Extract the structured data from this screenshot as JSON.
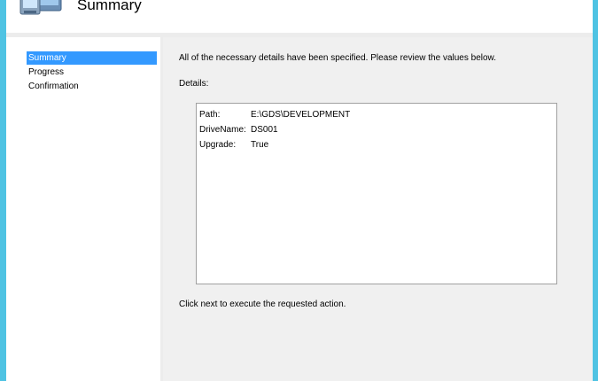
{
  "header": {
    "title": "Summary",
    "icon": "computer-icon"
  },
  "sidebar": {
    "items": [
      {
        "label": "Summary",
        "active": true
      },
      {
        "label": "Progress",
        "active": false
      },
      {
        "label": "Confirmation",
        "active": false
      }
    ]
  },
  "main": {
    "intro": "All of the necessary details have been specified.  Please review the values below.",
    "details_label": "Details:",
    "details": [
      {
        "key": "Path:",
        "value": "E:\\GDS\\DEVELOPMENT"
      },
      {
        "key": "DriveName:",
        "value": "DS001"
      },
      {
        "key": "Upgrade:",
        "value": "True"
      }
    ],
    "footer": "Click next to execute the requested action."
  },
  "colors": {
    "frame": "#4fc3e3",
    "selection": "#3399ff",
    "content_bg": "#f0f0f0"
  }
}
